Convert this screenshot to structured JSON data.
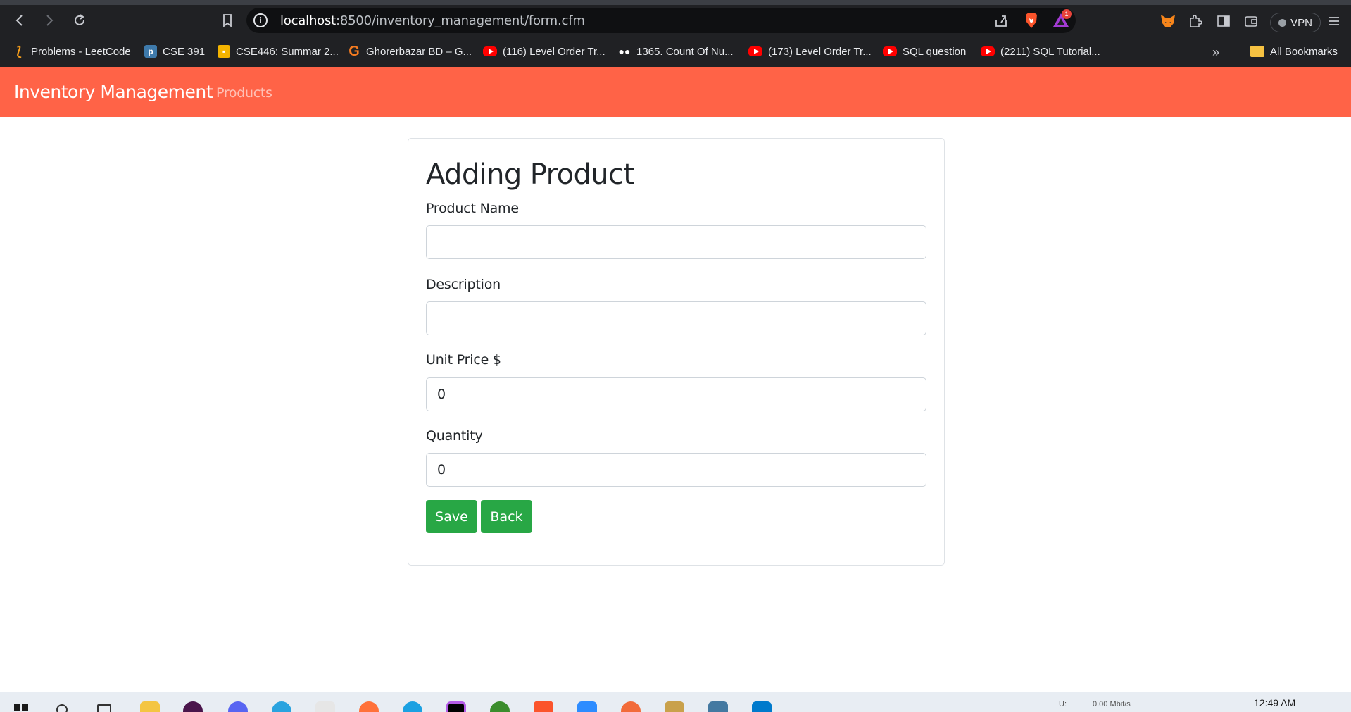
{
  "browser": {
    "url_host": "localhost",
    "url_path": ":8500/inventory_management/form.cfm",
    "rewards_badge": "1",
    "vpn_label": "VPN",
    "bookmarks": [
      {
        "label": "Problems - LeetCode",
        "icon": "leetcode-icon",
        "color": "#f89f1b"
      },
      {
        "label": "CSE 391",
        "icon": "piazza-icon",
        "color": "#3e7aab"
      },
      {
        "label": "CSE446: Summar 2...",
        "icon": "classroom-icon",
        "color": "#f4b400"
      },
      {
        "label": "Ghorerbazar BD – G...",
        "icon": "ghorerbazar-icon",
        "color": "#f47b20"
      },
      {
        "label": "(116) Level Order Tr...",
        "icon": "youtube-icon",
        "color": "#ff0000"
      },
      {
        "label": "1365. Count Of Nu...",
        "icon": "medium-icon",
        "color": "#000000"
      },
      {
        "label": "(173) Level Order Tr...",
        "icon": "youtube-icon",
        "color": "#ff0000"
      },
      {
        "label": "SQL question",
        "icon": "youtube-icon",
        "color": "#ff0000"
      },
      {
        "label": "(2211) SQL Tutorial...",
        "icon": "youtube-icon",
        "color": "#ff0000"
      }
    ],
    "all_bookmarks_label": "All Bookmarks"
  },
  "navbar": {
    "brand": "Inventory Management",
    "link_products": "Products",
    "bg_color": "#ff6347"
  },
  "form": {
    "title": "Adding Product",
    "fields": [
      {
        "label": "Product Name",
        "value": ""
      },
      {
        "label": "Description",
        "value": ""
      },
      {
        "label": "Unit Price $",
        "value": "0"
      },
      {
        "label": "Quantity",
        "value": "0"
      }
    ],
    "save_label": "Save",
    "back_label": "Back",
    "button_color": "#28a745"
  },
  "taskbar": {
    "net_label": "U:",
    "net_speed": "0.00 Mbit/s",
    "clock": "12:49 AM"
  }
}
